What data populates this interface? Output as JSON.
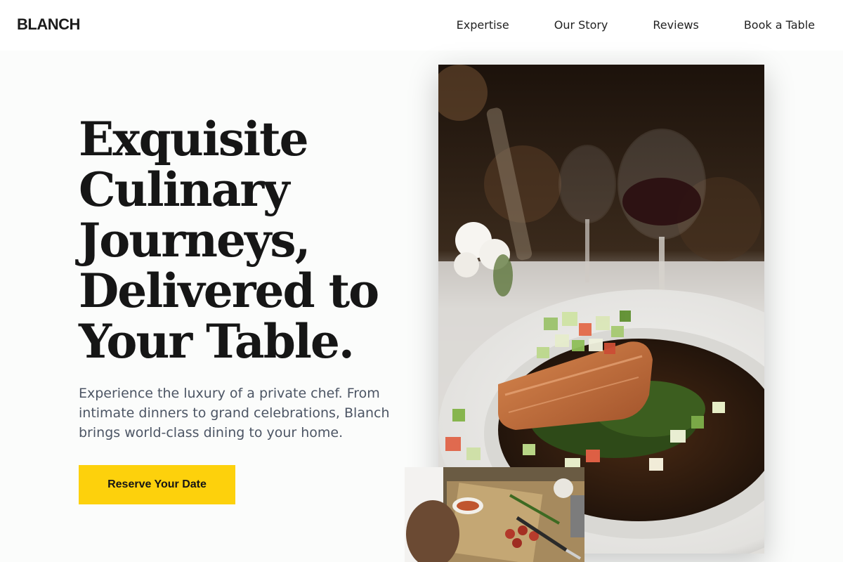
{
  "brand": {
    "name": "BLANCH"
  },
  "nav": {
    "items": [
      {
        "label": "Expertise"
      },
      {
        "label": "Our Story"
      },
      {
        "label": "Reviews"
      },
      {
        "label": "Book a Table"
      }
    ]
  },
  "hero": {
    "title": "Exquisite Culinary Journeys, Delivered to Your Table.",
    "subtitle": "Experience the luxury of a private chef. From intimate dinners to grand celebrations, Blanch brings world-class dining to your home.",
    "cta_label": "Reserve Your Date"
  },
  "images": {
    "main": {
      "icon": "plated-salmon-photo"
    },
    "secondary": {
      "icon": "chef-prep-photo"
    }
  },
  "colors": {
    "accent": "#fdd10c",
    "text_dark": "#161616",
    "text_muted": "#4c5564",
    "background": "#fbfcfb"
  }
}
